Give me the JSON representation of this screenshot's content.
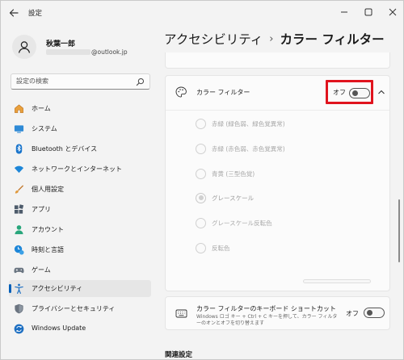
{
  "window": {
    "app_title": "設定"
  },
  "user": {
    "name": "秋葉一郎",
    "email_domain": "@outlook.jp"
  },
  "search": {
    "placeholder": "設定の検索"
  },
  "sidebar": {
    "items": [
      {
        "label": "ホーム",
        "icon": "home-icon"
      },
      {
        "label": "システム",
        "icon": "system-icon"
      },
      {
        "label": "Bluetooth とデバイス",
        "icon": "bluetooth-icon"
      },
      {
        "label": "ネットワークとインターネット",
        "icon": "network-icon"
      },
      {
        "label": "個人用設定",
        "icon": "personalization-icon"
      },
      {
        "label": "アプリ",
        "icon": "apps-icon"
      },
      {
        "label": "アカウント",
        "icon": "account-icon"
      },
      {
        "label": "時刻と言語",
        "icon": "time-language-icon"
      },
      {
        "label": "ゲーム",
        "icon": "gaming-icon"
      },
      {
        "label": "アクセシビリティ",
        "icon": "accessibility-icon",
        "active": true
      },
      {
        "label": "プライバシーとセキュリティ",
        "icon": "privacy-icon"
      },
      {
        "label": "Windows Update",
        "icon": "windows-update-icon"
      }
    ]
  },
  "header": {
    "parent": "アクセシビリティ",
    "separator": "›",
    "current": "カラー フィルター"
  },
  "color_filter": {
    "title": "カラー フィルター",
    "toggle_label": "オフ",
    "toggle_state": "off",
    "options": [
      {
        "label": "赤緑 (緑色弱、緑色覚異常)",
        "checked": false
      },
      {
        "label": "赤緑 (赤色弱、赤色覚異常)",
        "checked": false
      },
      {
        "label": "青黄 (三型色覚)",
        "checked": false
      },
      {
        "label": "グレースケール",
        "checked": true
      },
      {
        "label": "グレースケール反転色",
        "checked": false
      },
      {
        "label": "反転色",
        "checked": false
      }
    ]
  },
  "shortcut": {
    "title": "カラー フィルターのキーボード ショートカット",
    "description": "Windows ロゴ キー + Ctrl + C キーを押して、カラー フィルターのオンとオフを切り替えます",
    "toggle_label": "オフ",
    "toggle_state": "off"
  },
  "related": {
    "title": "関連設定"
  },
  "colors": {
    "accent": "#005fb8",
    "highlight_box": "#e0141e"
  }
}
